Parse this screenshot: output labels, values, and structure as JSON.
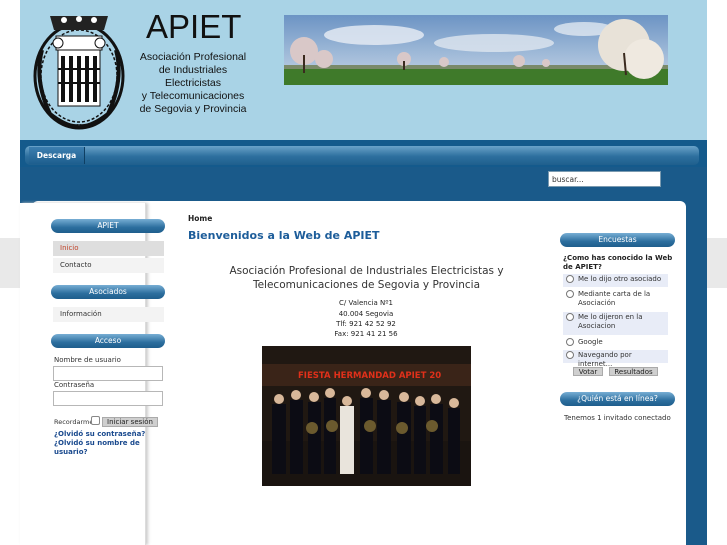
{
  "header": {
    "logo_title": "APIET",
    "logo_subtitle_lines": [
      "Asociación Profesional",
      "de Industriales",
      "Electricistas",
      "y Telecomunicaciones",
      "de Segovia y Provincia"
    ]
  },
  "nav": {
    "items": [
      {
        "label": "Descarga"
      }
    ]
  },
  "search": {
    "placeholder": "buscar..."
  },
  "left": {
    "apiet_title": "APIET",
    "apiet_items": [
      {
        "label": "Inicio"
      },
      {
        "label": "Contacto"
      }
    ],
    "asociados_title": "Asociados",
    "asociados_items": [
      {
        "label": "Información"
      }
    ],
    "acceso_title": "Acceso",
    "username_label": "Nombre de usuario",
    "password_label": "Contraseña",
    "remember_label": "Recordarme",
    "login_button": "Iniciar sesión",
    "forgot_password": "¿Olvidó su contraseña?",
    "forgot_username_1": "¿Olvidó su nombre de",
    "forgot_username_2": "usuario?"
  },
  "main": {
    "breadcrumb": "Home",
    "heading": "Bienvenidos a la Web de APIET",
    "org_name_1": "Asociación Profesional de Industriales Electricistas y",
    "org_name_2": "Telecomunicaciones de Segovia y Provincia",
    "address": [
      "C/ Valencia Nº1",
      "40.004 Segovia",
      "Tlf: 921 42 52 92",
      "Fax: 921 41 21 56"
    ],
    "photo_banner_text": "FIESTA HERMANDAD APIET 20"
  },
  "right": {
    "poll_title": "Encuestas",
    "poll_question": "¿Como has conocido la Web de APIET?",
    "poll_options": [
      {
        "label": "Me lo dijo otro asociado"
      },
      {
        "label": "Mediante carta de la Asociación"
      },
      {
        "label": "Me lo dijeron en la Asociacion"
      },
      {
        "label": "Google"
      },
      {
        "label": "Navegando por internet..."
      }
    ],
    "vote_button": "Votar",
    "results_button": "Resultados",
    "online_title": "¿Quién está en línea?",
    "online_text": "Tenemos 1 invitado conectado"
  },
  "colors": {
    "header_bg": "#a9d3e6",
    "page_blue": "#1a5a8a",
    "heading_blue": "#1d5d9a",
    "active_link": "#c0442a"
  }
}
